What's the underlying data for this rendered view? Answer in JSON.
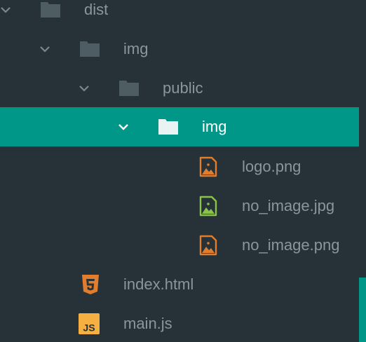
{
  "explorer": {
    "dist": {
      "label": "dist",
      "icon": "folder-icon"
    },
    "img": {
      "label": "img",
      "icon": "folder-icon"
    },
    "public": {
      "label": "public",
      "icon": "folder-icon"
    },
    "img_selected": {
      "label": "img",
      "icon": "folder-icon"
    },
    "logo": {
      "label": "logo.png",
      "icon": "image-icon"
    },
    "no_image_jpg": {
      "label": "no_image.jpg",
      "icon": "image-icon"
    },
    "no_image_png": {
      "label": "no_image.png",
      "icon": "image-icon"
    },
    "index_html": {
      "label": "index.html",
      "icon": "html5-icon"
    },
    "main_js": {
      "label": "main.js",
      "icon": "javascript-icon",
      "badge": "JS"
    }
  },
  "colors": {
    "background": "#263238",
    "selected": "#009688",
    "text": "#8a969c",
    "folder": "#4e5c63",
    "png_icon": "#e07d2f",
    "jpg_icon": "#8bc34a",
    "js_icon": "#f5b041"
  }
}
